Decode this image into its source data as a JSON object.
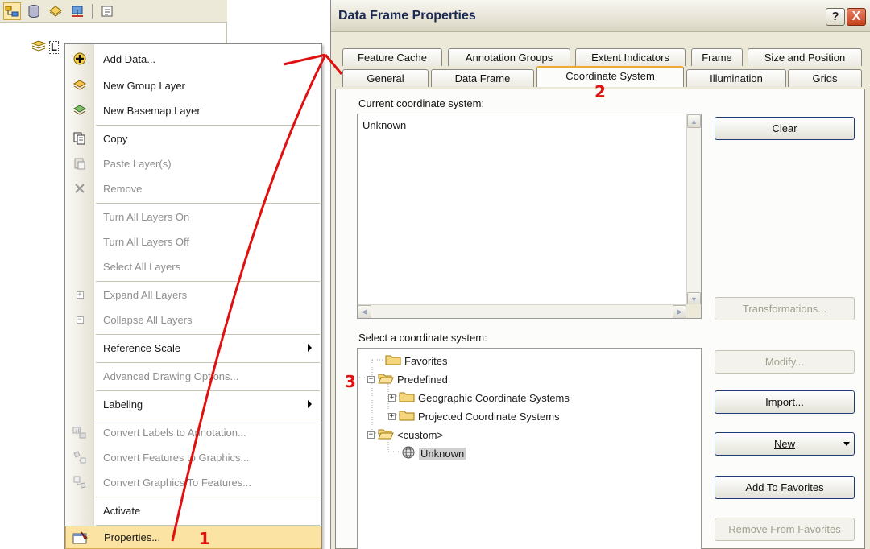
{
  "toc": {
    "layers_label": "L"
  },
  "context_menu": {
    "items": [
      {
        "label": "Add Data...",
        "icon": "add-data-icon",
        "disabled": false
      },
      {
        "label": "New Group Layer",
        "icon": "group-layer-icon",
        "disabled": false
      },
      {
        "label": "New Basemap Layer",
        "icon": "basemap-layer-icon",
        "disabled": false
      },
      {
        "label": "Copy",
        "icon": "copy-icon",
        "disabled": false
      },
      {
        "label": "Paste Layer(s)",
        "icon": "paste-icon",
        "disabled": true
      },
      {
        "label": "Remove",
        "icon": "remove-icon",
        "disabled": true
      },
      {
        "label": "Turn All Layers On",
        "icon": "",
        "disabled": true
      },
      {
        "label": "Turn All Layers Off",
        "icon": "",
        "disabled": true
      },
      {
        "label": "Select All Layers",
        "icon": "",
        "disabled": true
      },
      {
        "label": "Expand All Layers",
        "icon": "expand-icon",
        "disabled": true
      },
      {
        "label": "Collapse All Layers",
        "icon": "collapse-icon",
        "disabled": true
      },
      {
        "label": "Reference Scale",
        "icon": "",
        "disabled": false,
        "submenu": true
      },
      {
        "label": "Advanced Drawing Options...",
        "icon": "",
        "disabled": true
      },
      {
        "label": "Labeling",
        "icon": "",
        "disabled": false,
        "submenu": true
      },
      {
        "label": "Convert Labels to Annotation...",
        "icon": "convert-labels-icon",
        "disabled": true
      },
      {
        "label": "Convert Features to Graphics...",
        "icon": "convert-features-icon",
        "disabled": true
      },
      {
        "label": "Convert Graphics To Features...",
        "icon": "convert-graphics-icon",
        "disabled": true
      },
      {
        "label": "Activate",
        "icon": "",
        "disabled": false
      },
      {
        "label": "Properties...",
        "icon": "properties-icon",
        "disabled": false,
        "highlight": true
      }
    ]
  },
  "dialog": {
    "title": "Data Frame Properties",
    "help_label": "?",
    "close_label": "X",
    "tabs_row1": [
      "Feature Cache",
      "Annotation Groups",
      "Extent Indicators",
      "Frame",
      "Size and Position"
    ],
    "tabs_row2": [
      "General",
      "Data Frame",
      "Coordinate System",
      "Illumination",
      "Grids"
    ],
    "selected_tab": "Coordinate System",
    "current_label": "Current coordinate system:",
    "current_value": "Unknown",
    "select_label": "Select a coordinate system:",
    "tree": {
      "favorites": "Favorites",
      "predefined": "Predefined",
      "geographic": "Geographic Coordinate Systems",
      "projected": "Projected Coordinate Systems",
      "custom": "<custom>",
      "unknown": "Unknown"
    },
    "buttons": {
      "clear": "Clear",
      "transformations": "Transformations...",
      "modify": "Modify...",
      "import": "Import...",
      "new": "New",
      "add_favorites": "Add To Favorites",
      "remove_favorites": "Remove From Favorites"
    }
  },
  "annotations": {
    "step1": "1",
    "step2": "2",
    "step3": "3",
    "color": "#e01010"
  }
}
